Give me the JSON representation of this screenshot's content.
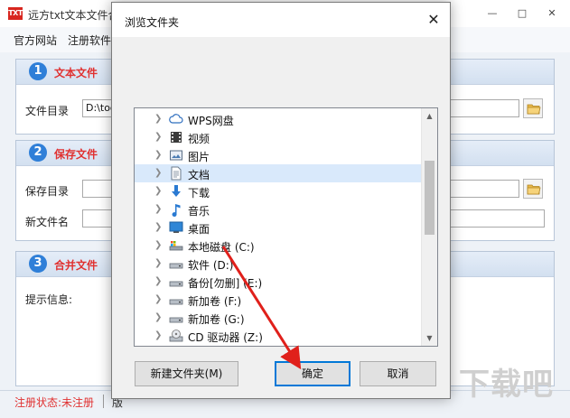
{
  "app": {
    "title": "远方txt文本文件合并",
    "logo_text": "TXT",
    "menu": [
      "官方网站",
      "注册软件"
    ],
    "window_buttons": {
      "minimize": "—",
      "restore": "□",
      "close": "✕"
    },
    "panels": [
      {
        "num": "1",
        "title": "文本文件",
        "rows": [
          {
            "label": "文件目录",
            "value": "D:\\tool"
          }
        ]
      },
      {
        "num": "2",
        "title": "保存文件",
        "rows": [
          {
            "label": "保存目录",
            "value": ""
          },
          {
            "label": "新文件名",
            "value": ""
          }
        ]
      },
      {
        "num": "3",
        "title": "合并文件",
        "rows": [
          {
            "label": "提示信息:"
          }
        ]
      }
    ],
    "status": {
      "registration": "注册状态:未注册",
      "version": "版"
    },
    "colors": {
      "accent": "#2f7fd8",
      "danger": "#e03131",
      "logo": "#d8261f"
    }
  },
  "dialog": {
    "title": "浏览文件夹",
    "close_glyph": "✕",
    "tree": [
      {
        "label": "WPS网盘",
        "icon": "cloud-icon"
      },
      {
        "label": "视频",
        "icon": "video-folder-icon"
      },
      {
        "label": "图片",
        "icon": "picture-folder-icon"
      },
      {
        "label": "文档",
        "icon": "document-folder-icon",
        "selected": true
      },
      {
        "label": "下载",
        "icon": "download-icon"
      },
      {
        "label": "音乐",
        "icon": "music-icon"
      },
      {
        "label": "桌面",
        "icon": "desktop-icon"
      },
      {
        "label": "本地磁盘 (C:)",
        "icon": "system-drive-icon"
      },
      {
        "label": "软件 (D:)",
        "icon": "drive-icon"
      },
      {
        "label": "备份[勿删] (E:)",
        "icon": "drive-icon"
      },
      {
        "label": "新加卷 (F:)",
        "icon": "drive-icon"
      },
      {
        "label": "新加卷 (G:)",
        "icon": "drive-icon"
      },
      {
        "label": "CD 驱动器 (Z:)",
        "icon": "cd-drive-icon"
      }
    ],
    "buttons": {
      "new_folder": "新建文件夹(M)",
      "ok": "确定",
      "cancel": "取消"
    },
    "scroll_glyphs": {
      "up": "▲",
      "down": "▼"
    }
  },
  "watermark": "下载吧"
}
